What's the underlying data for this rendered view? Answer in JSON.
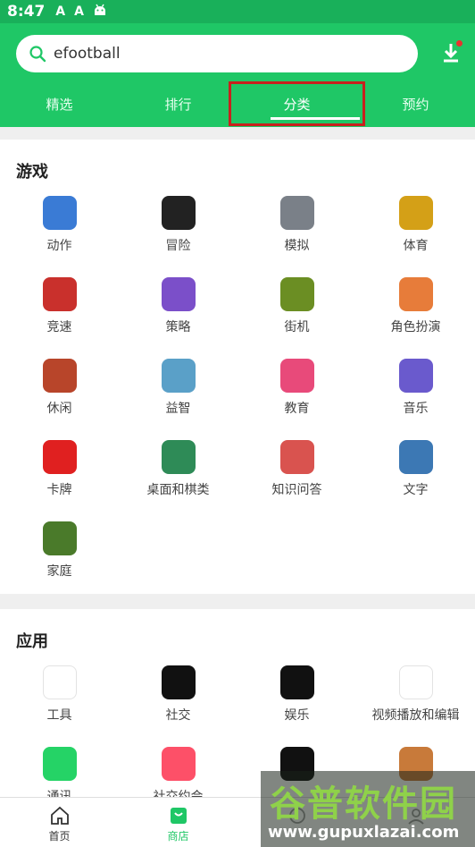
{
  "status_bar": {
    "time": "8:47",
    "icons": [
      "A",
      "A",
      "android-icon"
    ]
  },
  "search": {
    "query": "efootball"
  },
  "tabs": [
    {
      "label": "精选"
    },
    {
      "label": "排行"
    },
    {
      "label": "分类",
      "active": true
    },
    {
      "label": "预约"
    }
  ],
  "colors": {
    "brand": "#1fc766",
    "highlight_box": "#c8201d"
  },
  "games": {
    "title": "游戏",
    "categories": [
      {
        "label": "动作",
        "icon": "action-game-icon",
        "color": "#3a7bd5"
      },
      {
        "label": "冒险",
        "icon": "roblox-icon",
        "color": "#222222"
      },
      {
        "label": "模拟",
        "icon": "car-sim-icon",
        "color": "#7a8088"
      },
      {
        "label": "体育",
        "icon": "soccer-icon",
        "color": "#d4a017"
      },
      {
        "label": "竞速",
        "icon": "racing-car-icon",
        "color": "#c9302c"
      },
      {
        "label": "策略",
        "icon": "strategy-icon",
        "color": "#7b4fc9"
      },
      {
        "label": "街机",
        "icon": "minecraft-icon",
        "color": "#6b8e23"
      },
      {
        "label": "角色扮演",
        "icon": "roleplay-icon",
        "color": "#e77c3a"
      },
      {
        "label": "休闲",
        "icon": "casual-game-icon",
        "color": "#b8452a"
      },
      {
        "label": "益智",
        "icon": "puzzle-icon",
        "color": "#5aa0c8"
      },
      {
        "label": "教育",
        "icon": "education-icon",
        "color": "#e84a7a"
      },
      {
        "label": "音乐",
        "icon": "piano-tiles-icon",
        "color": "#6a5acd"
      },
      {
        "label": "卡牌",
        "icon": "uno-icon",
        "color": "#e02020"
      },
      {
        "label": "桌面和棋类",
        "icon": "ludo-icon",
        "color": "#2e8b57"
      },
      {
        "label": "知识问答",
        "icon": "brain-icon",
        "color": "#d9534f"
      },
      {
        "label": "文字",
        "icon": "word-game-icon",
        "color": "#3c78b4"
      },
      {
        "label": "家庭",
        "icon": "sonic-icon",
        "color": "#4a7a2a"
      }
    ]
  },
  "apps": {
    "title": "应用",
    "categories": [
      {
        "label": "工具",
        "icon": "play-store-icon",
        "color": "#ffffff"
      },
      {
        "label": "社交",
        "icon": "tiktok-icon",
        "color": "#111111"
      },
      {
        "label": "娱乐",
        "icon": "netflix-icon",
        "color": "#111111"
      },
      {
        "label": "视频播放和编辑",
        "icon": "youtube-icon",
        "color": "#ffffff"
      },
      {
        "label": "通讯",
        "icon": "whatsapp-icon",
        "color": "#25d366"
      },
      {
        "label": "社交约会",
        "icon": "tinder-icon",
        "color": "#fd5068"
      },
      {
        "label": "",
        "icon": "spotify-icon",
        "color": "#111111"
      },
      {
        "label": "",
        "icon": "phone-icon",
        "color": "#c87a3a"
      }
    ]
  },
  "bottom_nav": [
    {
      "label": "首页",
      "icon": "home-icon"
    },
    {
      "label": "商店",
      "icon": "store-icon",
      "active": true
    },
    {
      "label": "",
      "icon": "nav-icon-3"
    },
    {
      "label": "",
      "icon": "nav-icon-4"
    }
  ],
  "watermark": {
    "logo": "谷普软件园",
    "url": "www.gupuxlazai.com"
  }
}
